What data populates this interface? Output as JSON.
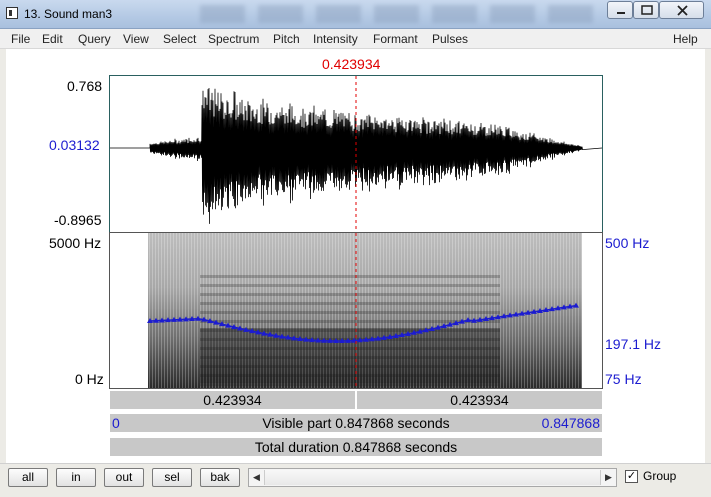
{
  "window": {
    "title": "13. Sound man3"
  },
  "menu": [
    "File",
    "Edit",
    "Query",
    "View",
    "Select",
    "Spectrum",
    "Pitch",
    "Intensity",
    "Formant",
    "Pulses",
    "Help"
  ],
  "cursor_time": "0.423934",
  "waveform": {
    "max_label": "0.768",
    "cursor_value_label": "0.03132",
    "min_label": "-0.8965"
  },
  "spectrogram": {
    "top_label": "5000 Hz",
    "bottom_label": "0 Hz",
    "pitch_top_label": "500 Hz",
    "pitch_value_label": "197.1 Hz",
    "pitch_bottom_label": "75 Hz"
  },
  "selection": {
    "left_duration": "0.423934",
    "right_duration": "0.423934"
  },
  "visible_part": {
    "start": "0",
    "text": "Visible part 0.847868 seconds",
    "end": "0.847868"
  },
  "total_duration": "Total duration 0.847868 seconds",
  "toolbar": {
    "all": "all",
    "in": "in",
    "out": "out",
    "sel": "sel",
    "bak": "bak",
    "group_label": "Group",
    "group_checked": "✓"
  },
  "colors": {
    "cursor": "#e00000",
    "pitch_track": "#1c1cd0"
  }
}
